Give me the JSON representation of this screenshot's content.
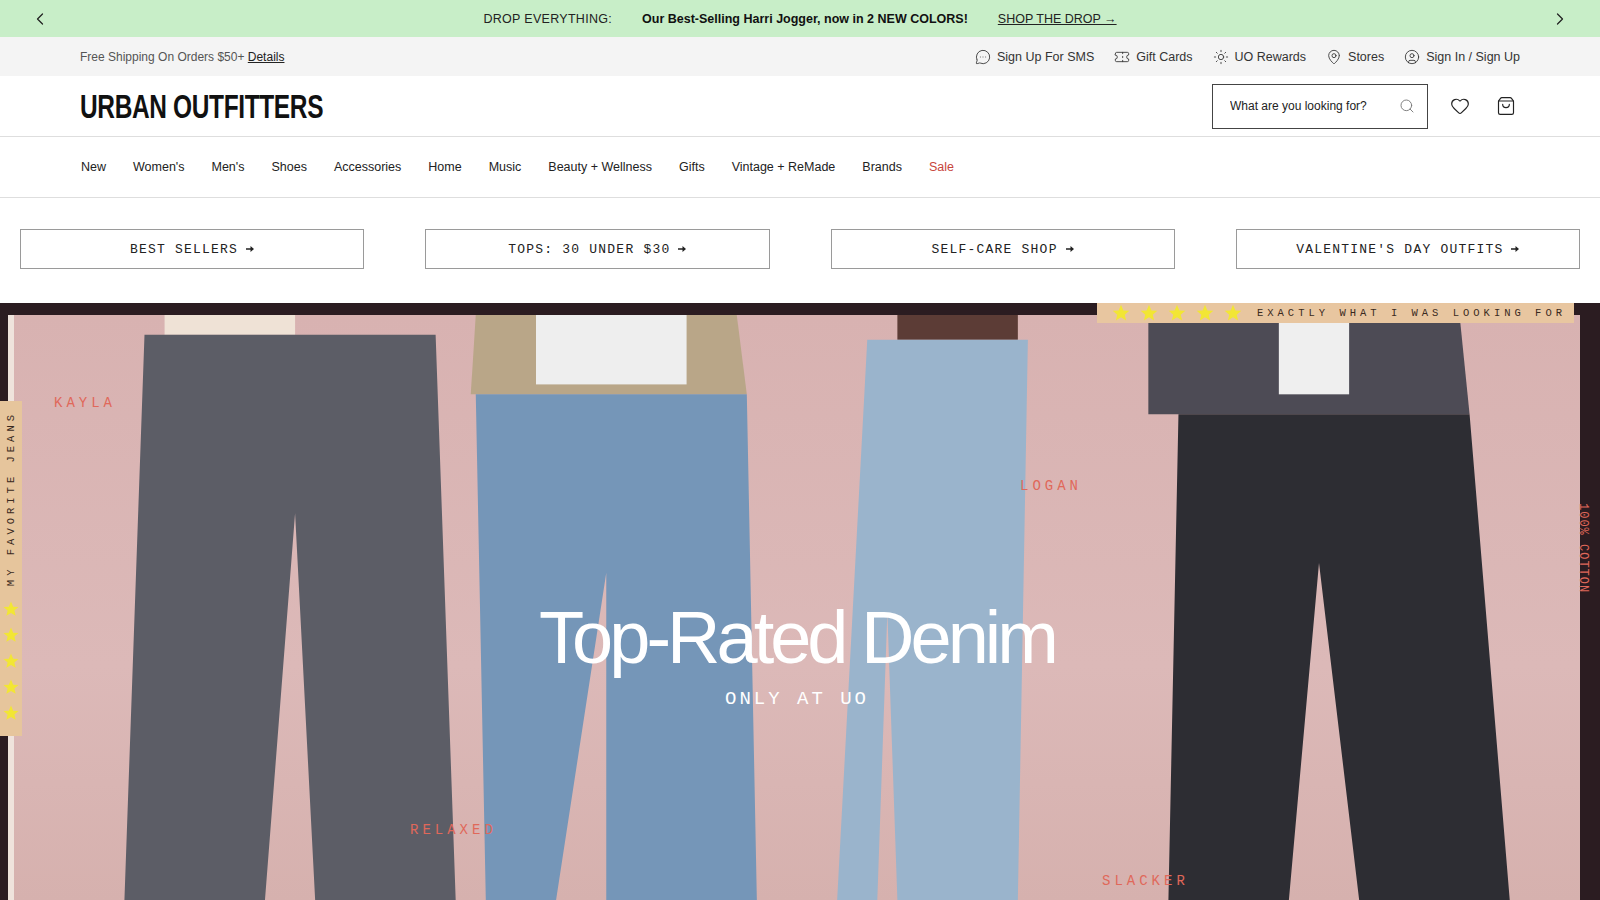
{
  "announcement": {
    "prefix": "DROP EVERYTHING:",
    "message": "Our Best-Selling Harri Jogger, now in 2 NEW COLORS!",
    "link": "SHOP THE DROP →"
  },
  "utility": {
    "shipping": "Free Shipping On Orders $50+",
    "details": "Details",
    "links": [
      {
        "label": "Sign Up For SMS"
      },
      {
        "label": "Gift Cards"
      },
      {
        "label": "UO Rewards"
      },
      {
        "label": "Stores"
      },
      {
        "label": "Sign In / Sign Up"
      }
    ]
  },
  "header": {
    "logo": "URBAN OUTFITTERS",
    "search": {
      "placeholder": "What are you looking for?"
    }
  },
  "nav": [
    {
      "label": "New",
      "color": "#222222"
    },
    {
      "label": "Women's",
      "color": "#222222"
    },
    {
      "label": "Men's",
      "color": "#222222"
    },
    {
      "label": "Shoes",
      "color": "#222222"
    },
    {
      "label": "Accessories",
      "color": "#222222"
    },
    {
      "label": "Home",
      "color": "#222222"
    },
    {
      "label": "Music",
      "color": "#222222"
    },
    {
      "label": "Beauty + Wellness",
      "color": "#222222"
    },
    {
      "label": "Gifts",
      "color": "#222222"
    },
    {
      "label": "Vintage + ReMade",
      "color": "#222222"
    },
    {
      "label": "Brands",
      "color": "#222222"
    },
    {
      "label": "Sale",
      "color": "#c8463c"
    }
  ],
  "quick_links": [
    {
      "label": "BEST SELLERS"
    },
    {
      "label": "TOPS: 30 UNDER $30"
    },
    {
      "label": "SELF-CARE SHOP"
    },
    {
      "label": "VALENTINE'S DAY OUTFITS"
    }
  ],
  "hero": {
    "title": "Top-Rated Denim",
    "subtitle": "ONLY AT UO",
    "tags": [
      {
        "label": "KAYLA"
      },
      {
        "label": "LOGAN"
      },
      {
        "label": "RELAXED"
      },
      {
        "label": "SLACKER"
      }
    ],
    "review": {
      "text": "EXACTLY WHAT I WAS LOOKING FOR",
      "stars": 5
    },
    "side_badge": {
      "text": "MY FAVORITE JEANS",
      "stars": 5
    },
    "cotton": "100% COTTON"
  }
}
